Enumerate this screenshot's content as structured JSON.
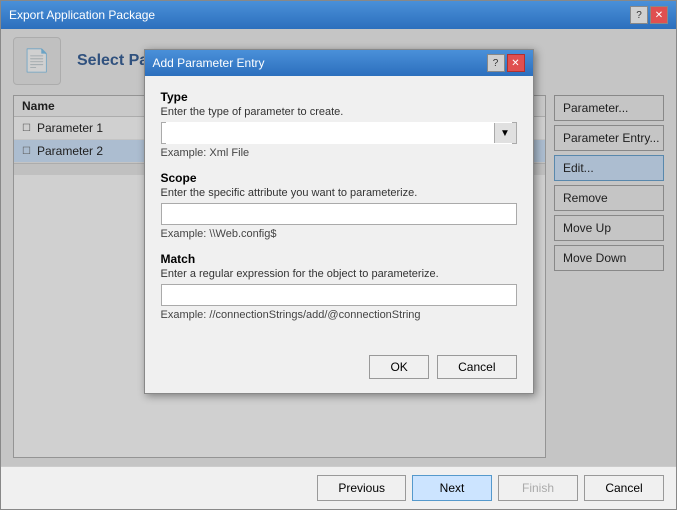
{
  "outerWindow": {
    "title": "Export Application Package",
    "helpBtn": "?",
    "closeBtn": "✕"
  },
  "pageHeader": {
    "title": "Select Parameters",
    "iconSymbol": "📄"
  },
  "listHeader": {
    "nameCol": "Name"
  },
  "listItems": [
    {
      "label": "Parameter 1",
      "selected": false
    },
    {
      "label": "Parameter 2",
      "selected": true
    }
  ],
  "rightButtons": [
    {
      "id": "add-param",
      "label": "Parameter..."
    },
    {
      "id": "add-param-entry",
      "label": "arameter Entry..."
    },
    {
      "id": "edit",
      "label": "Edit...",
      "highlighted": true
    },
    {
      "id": "remove",
      "label": "Remove"
    },
    {
      "id": "move-up",
      "label": "Move Up"
    },
    {
      "id": "move-down",
      "label": "ve Down"
    }
  ],
  "bottomNav": {
    "previousLabel": "Previous",
    "nextLabel": "Next",
    "finishLabel": "Finish",
    "cancelLabel": "Cancel"
  },
  "dialog": {
    "title": "Add Parameter Entry",
    "helpBtn": "?",
    "closeBtn": "✕",
    "fields": [
      {
        "id": "type",
        "label": "Type",
        "description": "Enter the type of parameter to create.",
        "inputType": "dropdown",
        "value": "",
        "example": "Example: Xml File"
      },
      {
        "id": "scope",
        "label": "Scope",
        "description": "Enter the specific attribute you want to parameterize.",
        "inputType": "text",
        "value": "",
        "example": "Example: \\\\Web.config$"
      },
      {
        "id": "match",
        "label": "Match",
        "description": "Enter a regular expression for the object to parameterize.",
        "inputType": "text",
        "value": "",
        "example": "Example: //connectionStrings/add/@connectionString"
      }
    ],
    "okLabel": "OK",
    "cancelLabel": "Cancel"
  }
}
